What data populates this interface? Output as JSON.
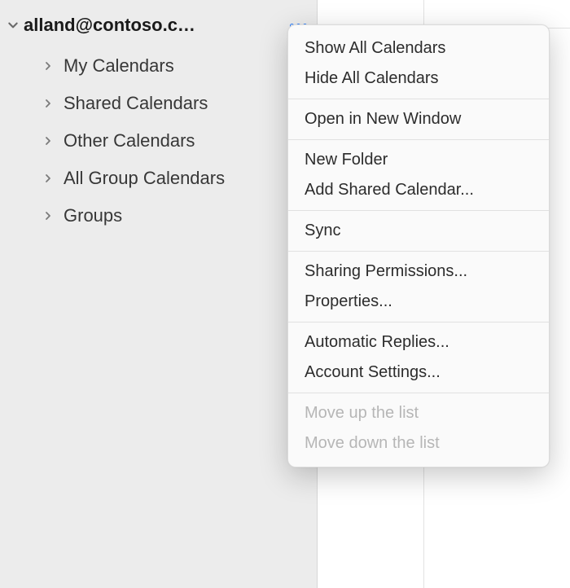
{
  "account": {
    "label": "alland@contoso.c…"
  },
  "folders": [
    {
      "label": "My Calendars"
    },
    {
      "label": "Shared Calendars"
    },
    {
      "label": "Other Calendars"
    },
    {
      "label": "All Group Calendars"
    },
    {
      "label": "Groups"
    }
  ],
  "menu": {
    "show_all": "Show All Calendars",
    "hide_all": "Hide All Calendars",
    "open_new_window": "Open in New Window",
    "new_folder": "New Folder",
    "add_shared": "Add Shared Calendar...",
    "sync": "Sync",
    "sharing_permissions": "Sharing Permissions...",
    "properties": "Properties...",
    "auto_replies": "Automatic Replies...",
    "account_settings": "Account Settings...",
    "move_up": "Move up the list",
    "move_down": "Move down the list"
  }
}
